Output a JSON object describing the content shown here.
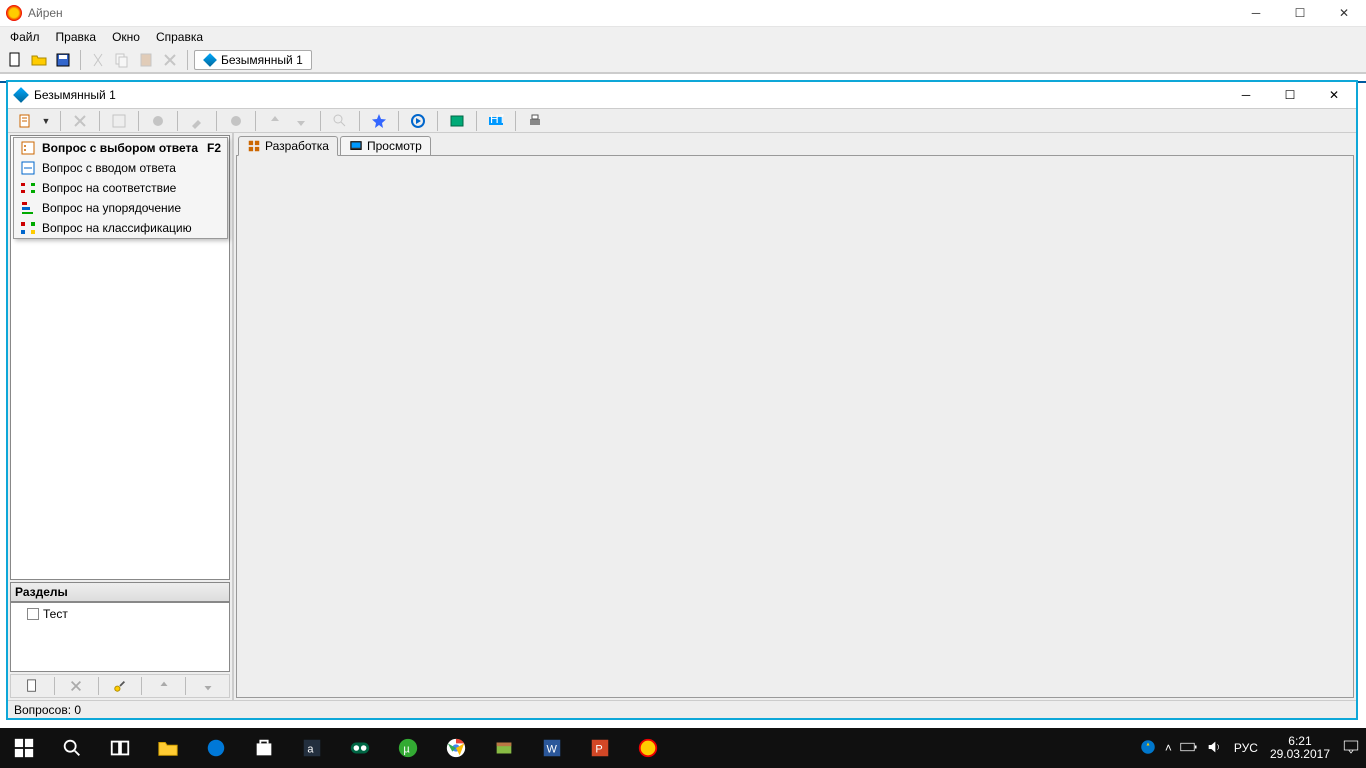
{
  "parent": {
    "title": "Айрен"
  },
  "menu": {
    "file": "Файл",
    "edit": "Правка",
    "window": "Окно",
    "help": "Справка"
  },
  "docTab": "Безымянный 1",
  "child": {
    "title": "Безымянный 1"
  },
  "dropdown": {
    "items": [
      {
        "label": "Вопрос с выбором ответа",
        "shortcut": "F2",
        "bold": true
      },
      {
        "label": "Вопрос с вводом ответа"
      },
      {
        "label": "Вопрос на соответствие"
      },
      {
        "label": "Вопрос на упорядочение"
      },
      {
        "label": "Вопрос на классификацию"
      }
    ]
  },
  "tabs": {
    "dev": "Разработка",
    "preview": "Просмотр"
  },
  "sectionsHeader": "Разделы",
  "treeItem": "Тест",
  "status": "Вопросов: 0",
  "tray": {
    "lang": "РУС",
    "time": "6:21",
    "date": "29.03.2017"
  }
}
